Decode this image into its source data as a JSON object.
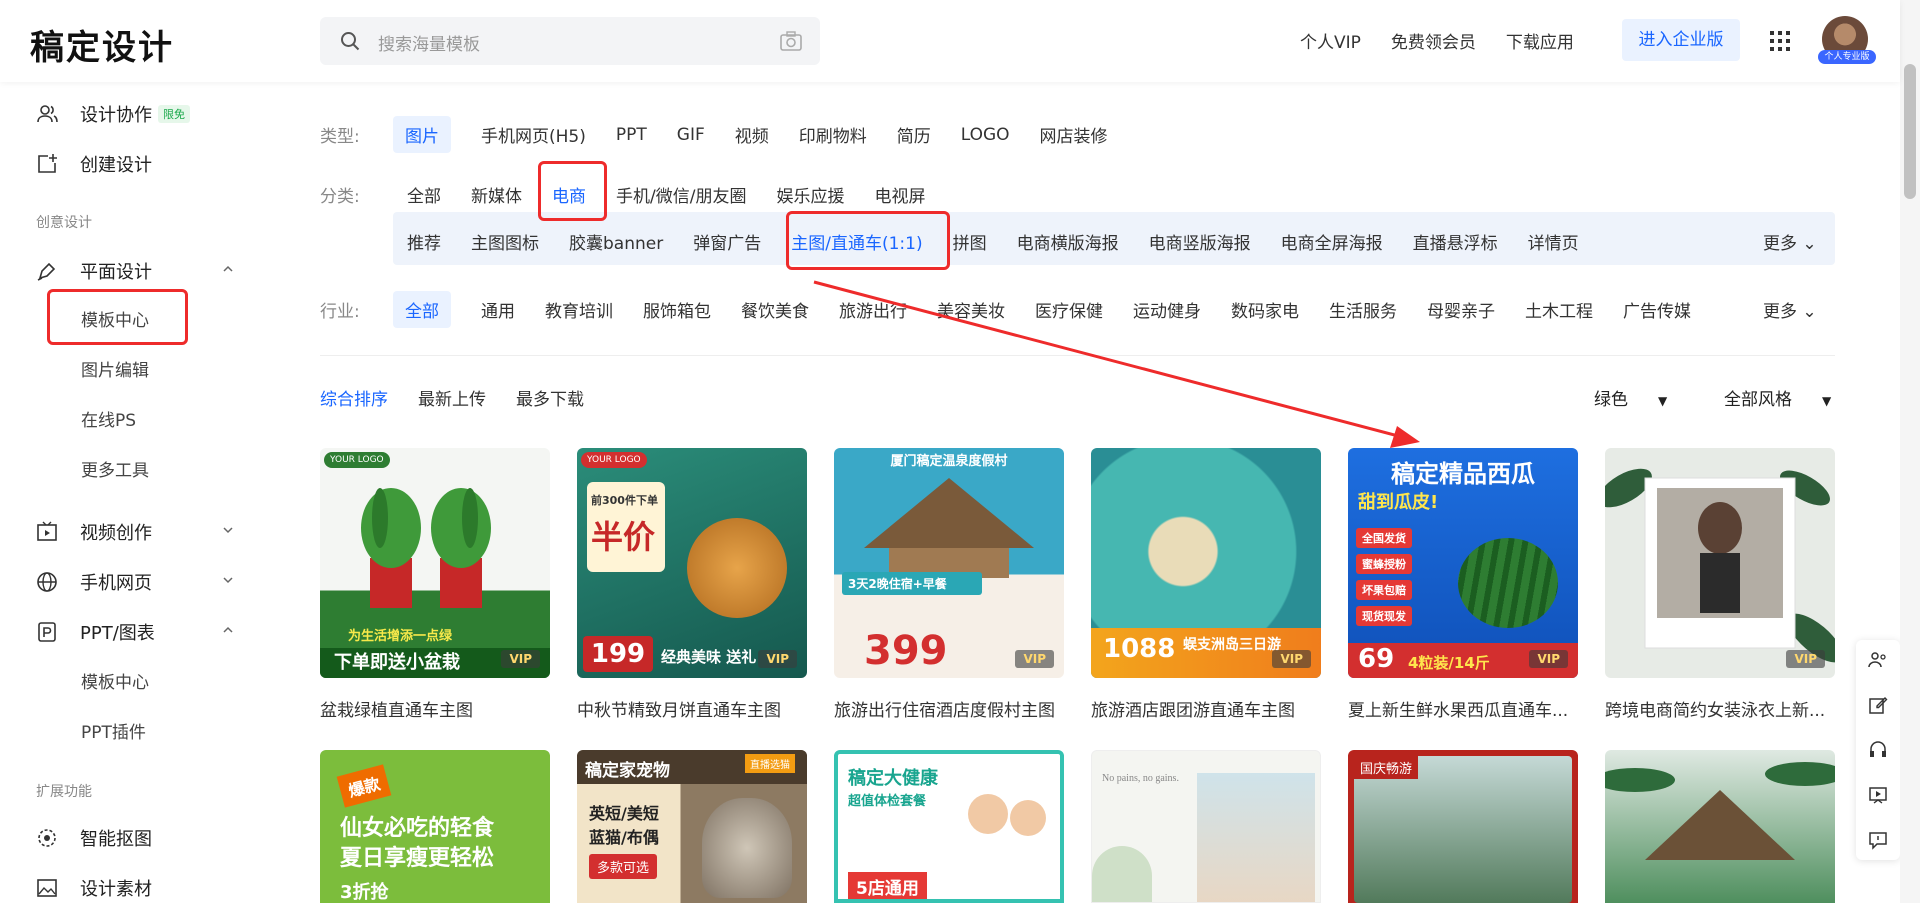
{
  "header": {
    "logo": "稿定设计",
    "search_placeholder": "搜索海量模板",
    "links": [
      "个人VIP",
      "免费领会员",
      "下载应用"
    ],
    "enterprise_label": "进入企业版",
    "avatar_badge": "个人专业版"
  },
  "sidebar": {
    "top_items": [
      {
        "label": "设计协作",
        "badge": "限免"
      },
      {
        "label": "创建设计"
      }
    ],
    "section_creative": "创意设计",
    "graphic": {
      "label": "平面设计",
      "children": [
        "模板中心",
        "图片编辑",
        "在线PS",
        "更多工具"
      ]
    },
    "video": {
      "label": "视频创作"
    },
    "mobile": {
      "label": "手机网页"
    },
    "ppt": {
      "label": "PPT/图表",
      "children": [
        "模板中心",
        "PPT插件"
      ]
    },
    "section_extend": "扩展功能",
    "extend_items": [
      "智能抠图",
      "设计素材"
    ]
  },
  "filters": {
    "type_label": "类型:",
    "types": [
      "图片",
      "手机网页(H5)",
      "PPT",
      "GIF",
      "视频",
      "印刷物料",
      "简历",
      "LOGO",
      "网店装修"
    ],
    "category_label": "分类:",
    "categories": [
      "全部",
      "新媒体",
      "电商",
      "手机/微信/朋友圈",
      "娱乐应援",
      "电视屏"
    ],
    "subcategories": [
      "推荐",
      "主图图标",
      "胶囊banner",
      "弹窗广告",
      "主图/直通车(1:1)",
      "拼图",
      "电商横版海报",
      "电商竖版海报",
      "电商全屏海报",
      "直播悬浮标",
      "详情页"
    ],
    "more_label": "更多",
    "industry_label": "行业:",
    "industries": [
      "全部",
      "通用",
      "教育培训",
      "服饰箱包",
      "餐饮美食",
      "旅游出行",
      "美容美妆",
      "医疗保健",
      "运动健身",
      "数码家电",
      "生活服务",
      "母婴亲子",
      "土木工程",
      "广告传媒"
    ]
  },
  "sort": {
    "options": [
      "综合排序",
      "最新上传",
      "最多下载"
    ],
    "color_select": "绿色",
    "style_select": "全部风格"
  },
  "cards": [
    {
      "title": "盆栽绿植直通车主图",
      "vip": "VIP",
      "lines": [
        "为生活增添一点绿",
        "下单即送小盆栽"
      ],
      "logo": "YOUR LOGO",
      "color": "#2e7d32"
    },
    {
      "title": "中秋节精致月饼直通车主图",
      "vip": "VIP",
      "lines": [
        "前300件下单",
        "半价",
        "经典美味 送礼",
        "199"
      ],
      "logo": "YOUR LOGO",
      "color": "#1b6b5e"
    },
    {
      "title": "旅游出行住宿酒店度假村主图",
      "vip": "VIP",
      "lines": [
        "厦门稿定温泉度假村",
        "3天2晚住宿+早餐",
        "399"
      ],
      "color": "#2aa7b5"
    },
    {
      "title": "旅游酒店跟团游直通车主图",
      "vip": "VIP",
      "lines": [
        "蜈支洲岛三日游",
        "1088"
      ],
      "color": "#3fa6a0"
    },
    {
      "title": "夏上新生鲜水果西瓜直通车...",
      "vip": "VIP",
      "lines": [
        "稿定精品西瓜",
        "甜到瓜皮!",
        "全国发货",
        "蜜蜂授粉",
        "坏果包赔",
        "现货现发",
        "69",
        "4粒装/14斤"
      ],
      "color": "#1565d8"
    },
    {
      "title": "跨境电商简约女装泳衣上新...",
      "vip": "VIP",
      "lines": [],
      "color": "#e9ece9"
    },
    {
      "title": "",
      "lines": [
        "爆款",
        "仙女必吃的轻食",
        "夏日享瘦更轻松",
        "3折抢"
      ],
      "color": "#7cbd3c"
    },
    {
      "title": "",
      "lines": [
        "稿定家宠物",
        "直播选猫",
        "英短/美短",
        "蓝猫/布偶",
        "多款可选"
      ],
      "color": "#5c4936"
    },
    {
      "title": "",
      "lines": [
        "稿定大健康",
        "超值体检套餐",
        "5店通用"
      ],
      "color": "#35c2b1"
    },
    {
      "title": "",
      "lines": [
        "No pains, no gains."
      ],
      "color": "#f1f3ee"
    },
    {
      "title": "",
      "lines": [
        "国庆畅游"
      ],
      "color": "#b8241d"
    },
    {
      "title": "",
      "lines": [],
      "color": "#4f8f5e"
    }
  ]
}
